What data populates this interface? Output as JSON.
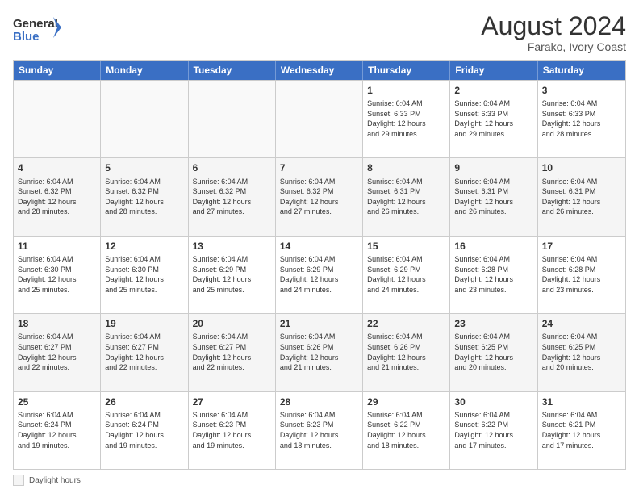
{
  "header": {
    "logo_line1": "General",
    "logo_line2": "Blue",
    "month_title": "August 2024",
    "location": "Farako, Ivory Coast"
  },
  "days_of_week": [
    "Sunday",
    "Monday",
    "Tuesday",
    "Wednesday",
    "Thursday",
    "Friday",
    "Saturday"
  ],
  "rows": [
    [
      {
        "day": "",
        "empty": true
      },
      {
        "day": "",
        "empty": true
      },
      {
        "day": "",
        "empty": true
      },
      {
        "day": "",
        "empty": true
      },
      {
        "day": "1",
        "info": "Sunrise: 6:04 AM\nSunset: 6:33 PM\nDaylight: 12 hours\nand 29 minutes."
      },
      {
        "day": "2",
        "info": "Sunrise: 6:04 AM\nSunset: 6:33 PM\nDaylight: 12 hours\nand 29 minutes."
      },
      {
        "day": "3",
        "info": "Sunrise: 6:04 AM\nSunset: 6:33 PM\nDaylight: 12 hours\nand 28 minutes."
      }
    ],
    [
      {
        "day": "4",
        "info": "Sunrise: 6:04 AM\nSunset: 6:32 PM\nDaylight: 12 hours\nand 28 minutes.",
        "shaded": true
      },
      {
        "day": "5",
        "info": "Sunrise: 6:04 AM\nSunset: 6:32 PM\nDaylight: 12 hours\nand 28 minutes.",
        "shaded": true
      },
      {
        "day": "6",
        "info": "Sunrise: 6:04 AM\nSunset: 6:32 PM\nDaylight: 12 hours\nand 27 minutes.",
        "shaded": true
      },
      {
        "day": "7",
        "info": "Sunrise: 6:04 AM\nSunset: 6:32 PM\nDaylight: 12 hours\nand 27 minutes.",
        "shaded": true
      },
      {
        "day": "8",
        "info": "Sunrise: 6:04 AM\nSunset: 6:31 PM\nDaylight: 12 hours\nand 26 minutes.",
        "shaded": true
      },
      {
        "day": "9",
        "info": "Sunrise: 6:04 AM\nSunset: 6:31 PM\nDaylight: 12 hours\nand 26 minutes.",
        "shaded": true
      },
      {
        "day": "10",
        "info": "Sunrise: 6:04 AM\nSunset: 6:31 PM\nDaylight: 12 hours\nand 26 minutes.",
        "shaded": true
      }
    ],
    [
      {
        "day": "11",
        "info": "Sunrise: 6:04 AM\nSunset: 6:30 PM\nDaylight: 12 hours\nand 25 minutes."
      },
      {
        "day": "12",
        "info": "Sunrise: 6:04 AM\nSunset: 6:30 PM\nDaylight: 12 hours\nand 25 minutes."
      },
      {
        "day": "13",
        "info": "Sunrise: 6:04 AM\nSunset: 6:29 PM\nDaylight: 12 hours\nand 25 minutes."
      },
      {
        "day": "14",
        "info": "Sunrise: 6:04 AM\nSunset: 6:29 PM\nDaylight: 12 hours\nand 24 minutes."
      },
      {
        "day": "15",
        "info": "Sunrise: 6:04 AM\nSunset: 6:29 PM\nDaylight: 12 hours\nand 24 minutes."
      },
      {
        "day": "16",
        "info": "Sunrise: 6:04 AM\nSunset: 6:28 PM\nDaylight: 12 hours\nand 23 minutes."
      },
      {
        "day": "17",
        "info": "Sunrise: 6:04 AM\nSunset: 6:28 PM\nDaylight: 12 hours\nand 23 minutes."
      }
    ],
    [
      {
        "day": "18",
        "info": "Sunrise: 6:04 AM\nSunset: 6:27 PM\nDaylight: 12 hours\nand 22 minutes.",
        "shaded": true
      },
      {
        "day": "19",
        "info": "Sunrise: 6:04 AM\nSunset: 6:27 PM\nDaylight: 12 hours\nand 22 minutes.",
        "shaded": true
      },
      {
        "day": "20",
        "info": "Sunrise: 6:04 AM\nSunset: 6:27 PM\nDaylight: 12 hours\nand 22 minutes.",
        "shaded": true
      },
      {
        "day": "21",
        "info": "Sunrise: 6:04 AM\nSunset: 6:26 PM\nDaylight: 12 hours\nand 21 minutes.",
        "shaded": true
      },
      {
        "day": "22",
        "info": "Sunrise: 6:04 AM\nSunset: 6:26 PM\nDaylight: 12 hours\nand 21 minutes.",
        "shaded": true
      },
      {
        "day": "23",
        "info": "Sunrise: 6:04 AM\nSunset: 6:25 PM\nDaylight: 12 hours\nand 20 minutes.",
        "shaded": true
      },
      {
        "day": "24",
        "info": "Sunrise: 6:04 AM\nSunset: 6:25 PM\nDaylight: 12 hours\nand 20 minutes.",
        "shaded": true
      }
    ],
    [
      {
        "day": "25",
        "info": "Sunrise: 6:04 AM\nSunset: 6:24 PM\nDaylight: 12 hours\nand 19 minutes."
      },
      {
        "day": "26",
        "info": "Sunrise: 6:04 AM\nSunset: 6:24 PM\nDaylight: 12 hours\nand 19 minutes."
      },
      {
        "day": "27",
        "info": "Sunrise: 6:04 AM\nSunset: 6:23 PM\nDaylight: 12 hours\nand 19 minutes."
      },
      {
        "day": "28",
        "info": "Sunrise: 6:04 AM\nSunset: 6:23 PM\nDaylight: 12 hours\nand 18 minutes."
      },
      {
        "day": "29",
        "info": "Sunrise: 6:04 AM\nSunset: 6:22 PM\nDaylight: 12 hours\nand 18 minutes."
      },
      {
        "day": "30",
        "info": "Sunrise: 6:04 AM\nSunset: 6:22 PM\nDaylight: 12 hours\nand 17 minutes."
      },
      {
        "day": "31",
        "info": "Sunrise: 6:04 AM\nSunset: 6:21 PM\nDaylight: 12 hours\nand 17 minutes."
      }
    ]
  ],
  "footer": {
    "shaded_label": "Daylight hours"
  }
}
